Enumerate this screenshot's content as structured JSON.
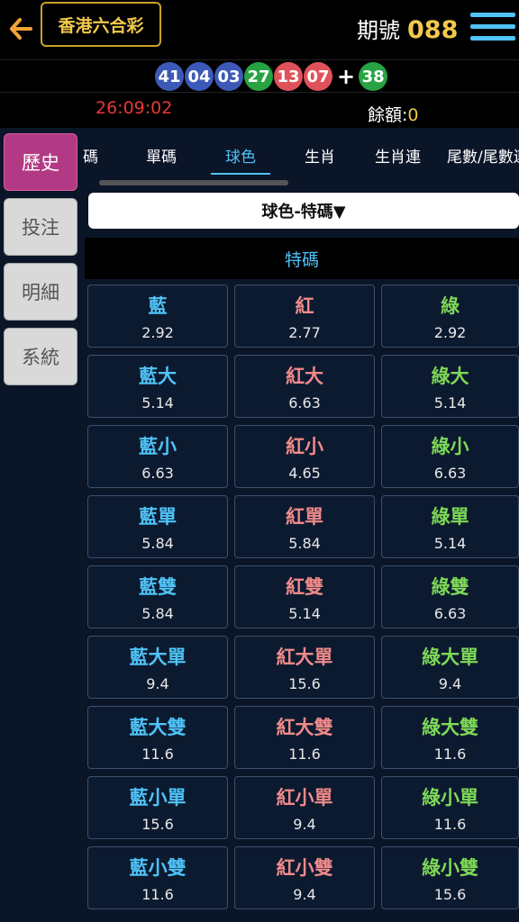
{
  "header": {
    "title": "香港六合彩",
    "period_label": "期號",
    "period_value": "088"
  },
  "result": {
    "balls": [
      {
        "num": "41",
        "color": "blue"
      },
      {
        "num": "04",
        "color": "blue"
      },
      {
        "num": "03",
        "color": "blue"
      },
      {
        "num": "27",
        "color": "green"
      },
      {
        "num": "13",
        "color": "red"
      },
      {
        "num": "07",
        "color": "red"
      }
    ],
    "special": {
      "num": "38",
      "color": "green"
    }
  },
  "status": {
    "timer": "26:09:02",
    "balance_label": "餘額:",
    "balance_value": "0"
  },
  "sidebar": {
    "items": [
      "歷史",
      "投注",
      "明細",
      "系統"
    ]
  },
  "tabs": [
    "碼",
    "單碼",
    "球色",
    "生肖",
    "生肖連",
    "尾數/尾數連"
  ],
  "dropdown": {
    "label": "球色-特碼▼"
  },
  "section": {
    "title": "特碼"
  },
  "grid": [
    [
      {
        "name": "藍",
        "odds": "2.92"
      },
      {
        "name": "紅",
        "odds": "2.77"
      },
      {
        "name": "綠",
        "odds": "2.92"
      }
    ],
    [
      {
        "name": "藍大",
        "odds": "5.14"
      },
      {
        "name": "紅大",
        "odds": "6.63"
      },
      {
        "name": "綠大",
        "odds": "5.14"
      }
    ],
    [
      {
        "name": "藍小",
        "odds": "6.63"
      },
      {
        "name": "紅小",
        "odds": "4.65"
      },
      {
        "name": "綠小",
        "odds": "6.63"
      }
    ],
    [
      {
        "name": "藍單",
        "odds": "5.84"
      },
      {
        "name": "紅單",
        "odds": "5.84"
      },
      {
        "name": "綠單",
        "odds": "5.14"
      }
    ],
    [
      {
        "name": "藍雙",
        "odds": "5.84"
      },
      {
        "name": "紅雙",
        "odds": "5.14"
      },
      {
        "name": "綠雙",
        "odds": "6.63"
      }
    ],
    [
      {
        "name": "藍大單",
        "odds": "9.4"
      },
      {
        "name": "紅大單",
        "odds": "15.6"
      },
      {
        "name": "綠大單",
        "odds": "9.4"
      }
    ],
    [
      {
        "name": "藍大雙",
        "odds": "11.6"
      },
      {
        "name": "紅大雙",
        "odds": "11.6"
      },
      {
        "name": "綠大雙",
        "odds": "11.6"
      }
    ],
    [
      {
        "name": "藍小單",
        "odds": "15.6"
      },
      {
        "name": "紅小單",
        "odds": "9.4"
      },
      {
        "name": "綠小單",
        "odds": "11.6"
      }
    ],
    [
      {
        "name": "藍小雙",
        "odds": "11.6"
      },
      {
        "name": "紅小雙",
        "odds": "9.4"
      },
      {
        "name": "綠小雙",
        "odds": "15.6"
      }
    ]
  ],
  "colors": {
    "accent": "#4fc3f7",
    "gold": "#f2c94c",
    "active_nav": "#b23a84",
    "timer": "#e53935"
  }
}
